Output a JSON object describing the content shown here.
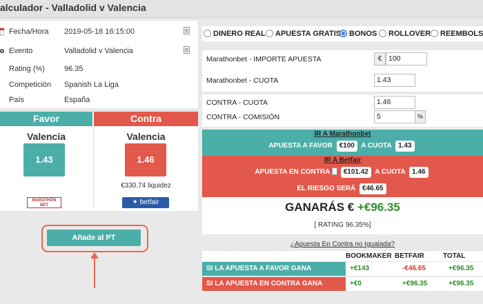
{
  "window": {
    "title": "alculador - Valladolid v Valencia"
  },
  "info": [
    {
      "label": "Fecha/Hora",
      "value": "2019-05-18 16:15:00"
    },
    {
      "label": "Evento",
      "value": "Valladolid v Valencia"
    },
    {
      "label": "Rating (%)",
      "value": "96.35"
    },
    {
      "label": "Competición",
      "value": "Spanish La Liga"
    },
    {
      "label": "País",
      "value": "España"
    }
  ],
  "favor": {
    "header": "Favor",
    "team": "Valencia",
    "odds": "1.43",
    "logo": "MARATHON BET"
  },
  "contra": {
    "header": "Contra",
    "team": "Valencia",
    "odds": "1.46",
    "liquidity": "€330.74 liquidez",
    "logo": "betfair"
  },
  "add_button": "Añade al PT",
  "modes": [
    {
      "label": "DINERO REAL",
      "selected": false
    },
    {
      "label": "APUESTA GRATIS",
      "selected": false
    },
    {
      "label": "BONOS",
      "selected": true
    },
    {
      "label": "ROLLOVER",
      "selected": false
    },
    {
      "label": "REEMBOLSO",
      "selected": false
    }
  ],
  "fields": {
    "importe": {
      "label": "Marathonbet - IMPORTE APUESTA",
      "prefix": "€",
      "value": "100"
    },
    "cuota": {
      "label": "Marathonbet - CUOTA",
      "value": "1.43"
    },
    "contra_cuota": {
      "label": "CONTRA - CUOTA",
      "value": "1.46"
    },
    "contra_comision": {
      "label": "CONTRA - COMISIÓN",
      "value": "5",
      "suffix": "%"
    }
  },
  "marathon_section": {
    "title": "IR A Marathonbet",
    "bet_label": "APUESTA A FAVOR",
    "bet_value": "€100",
    "odds_label": "A CUOTA",
    "odds_value": "1.43"
  },
  "betfair_section": {
    "title": "IR A Betfair",
    "bet_label": "APUESTA EN CONTRA",
    "bet_value": "€101.42",
    "odds_label": "A CUOTA",
    "odds_value": "1.46",
    "risk_label": "EL RIESGO SERÁ",
    "risk_value": "€46.65"
  },
  "result": {
    "label": "GANARÁS €",
    "value": "+€96.35",
    "rating": "[ RATING 96.35%]"
  },
  "uneven_link": "¿Apuesta En Contra no Igualada?",
  "table": {
    "headers": [
      "BOOKMAKER",
      "BETFAIR",
      "TOTAL"
    ],
    "rows": [
      {
        "label": "SI LA APUESTA A FAVOR GANA",
        "bookmaker": "+€143",
        "betfair": "-€46.65",
        "total": "+€96.35"
      },
      {
        "label": "SI LA APUESTA EN CONTRA GANA",
        "bookmaker": "+€0",
        "betfair": "+€96.35",
        "total": "+€96.35"
      }
    ]
  },
  "colors": {
    "green": "#4caea8",
    "red": "#e2584a",
    "accent": "#e8694a"
  }
}
